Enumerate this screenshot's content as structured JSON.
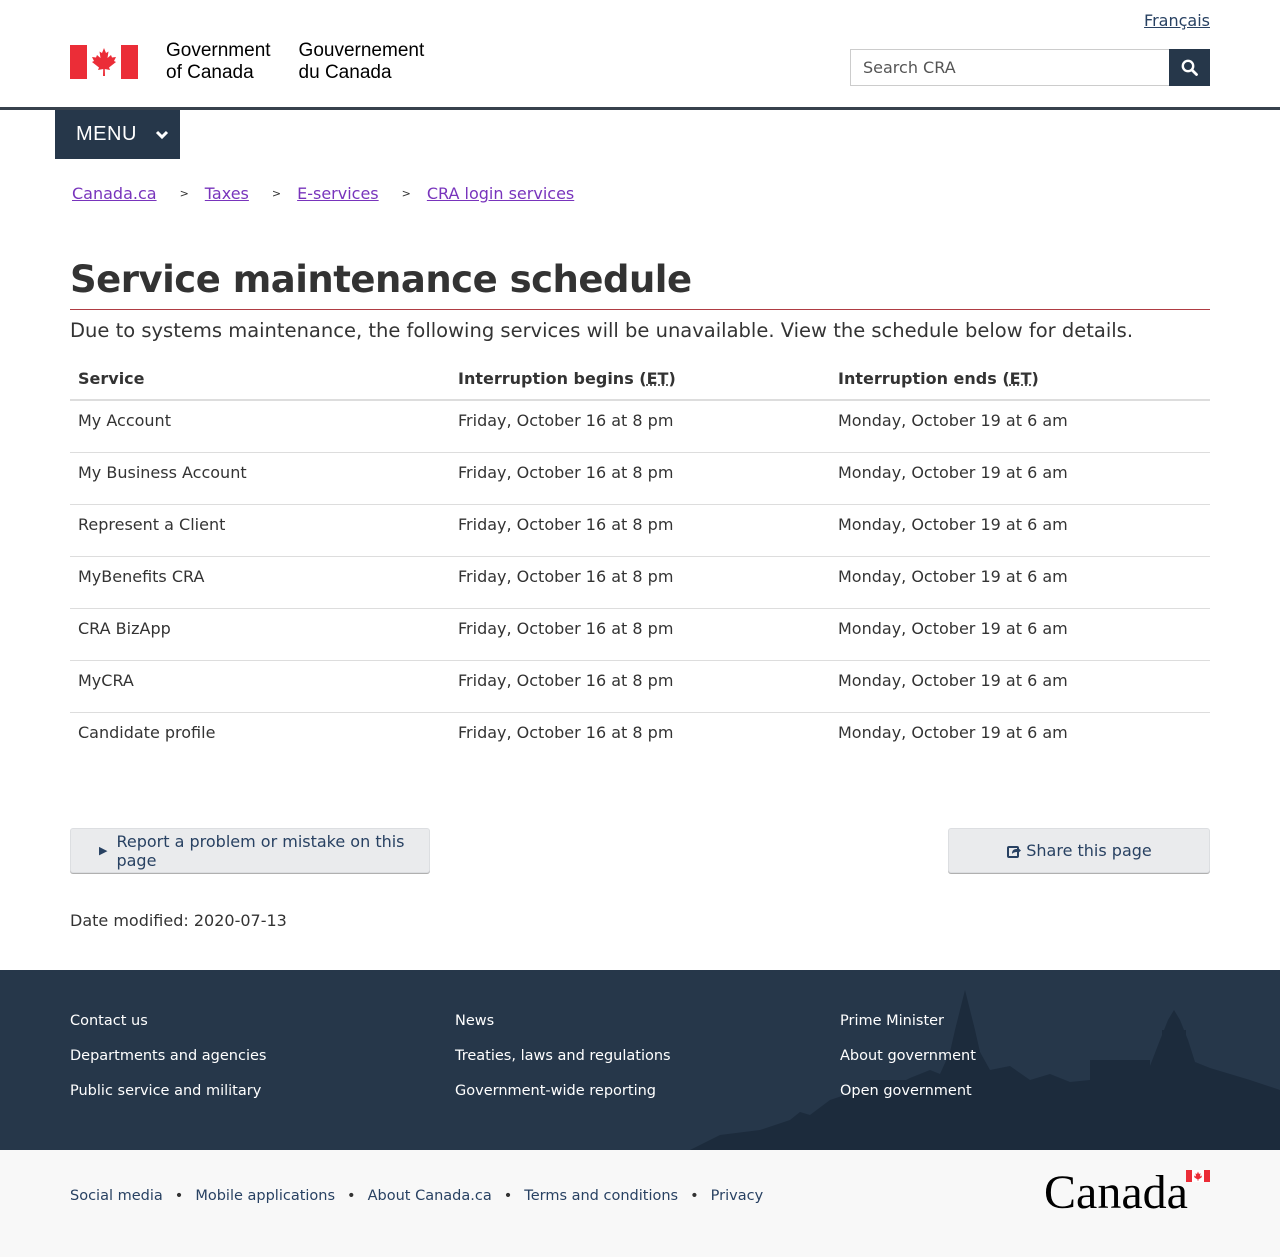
{
  "header": {
    "language_link": "Français",
    "signature_en_line1": "Government",
    "signature_en_line2": "of Canada",
    "signature_fr_line1": "Gouvernement",
    "signature_fr_line2": "du Canada",
    "search_placeholder": "Search CRA",
    "menu_label": "MENU"
  },
  "breadcrumb": {
    "items": [
      "Canada.ca",
      "Taxes",
      "E-services",
      "CRA login services"
    ],
    "separator": ">"
  },
  "main": {
    "title": "Service maintenance schedule",
    "intro": "Due to systems maintenance, the following services will be unavailable. View the schedule below for details.",
    "table": {
      "headers": {
        "service": "Service",
        "begins_prefix": "Interruption begins (",
        "ends_prefix": "Interruption ends (",
        "abbr": "ET",
        "suffix": ")"
      },
      "rows": [
        {
          "service": "My Account",
          "begins": "Friday, October 16 at 8 pm",
          "ends": "Monday, October 19 at 6 am"
        },
        {
          "service": "My Business Account",
          "begins": "Friday, October 16 at 8 pm",
          "ends": "Monday, October 19 at 6 am"
        },
        {
          "service": "Represent a Client",
          "begins": "Friday, October 16 at 8 pm",
          "ends": "Monday, October 19 at 6 am"
        },
        {
          "service": "MyBenefits CRA",
          "begins": "Friday, October 16 at 8 pm",
          "ends": "Monday, October 19 at 6 am"
        },
        {
          "service": "CRA BizApp",
          "begins": "Friday, October 16 at 8 pm",
          "ends": "Monday, October 19 at 6 am"
        },
        {
          "service": "MyCRA",
          "begins": "Friday, October 16 at 8 pm",
          "ends": "Monday, October 19 at 6 am"
        },
        {
          "service": "Candidate profile",
          "begins": "Friday, October 16 at 8 pm",
          "ends": "Monday, October 19 at 6 am"
        }
      ]
    },
    "report_button": "Report a problem or mistake on this page",
    "share_button": "Share this page",
    "date_modified_label": "Date modified:",
    "date_modified_value": "2020-07-13"
  },
  "footer": {
    "col1": [
      "Contact us",
      "Departments and agencies",
      "Public service and military"
    ],
    "col2": [
      "News",
      "Treaties, laws and regulations",
      "Government-wide reporting"
    ],
    "col3": [
      "Prime Minister",
      "About government",
      "Open government"
    ],
    "sub_links": [
      "Social media",
      "Mobile applications",
      "About Canada.ca",
      "Terms and conditions",
      "Privacy"
    ],
    "wordmark": "Canada"
  },
  "colors": {
    "navy": "#26374a",
    "link": "#284162",
    "visited_link": "#7834bc",
    "flag_red": "#eb2d37",
    "title_rule": "#af3c43"
  },
  "icons": [
    "maple-leaf-icon",
    "search-icon",
    "chevron-down-icon",
    "triangle-right-icon",
    "share-icon"
  ]
}
